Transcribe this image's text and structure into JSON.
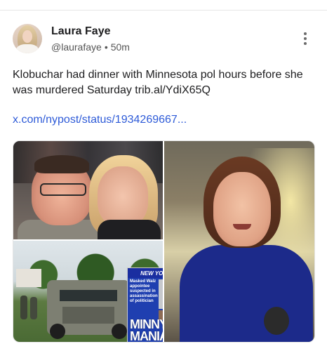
{
  "post": {
    "author_name": "Laura Faye",
    "author_handle": "@laurafaye",
    "separator": "•",
    "timestamp": "50m",
    "text": "Klobuchar had dinner with Minnesota pol hours before she was murdered Saturday trib.al/YdiX65Q",
    "link": "x.com/nypost/status/1934269667..."
  },
  "media": {
    "newspaper": {
      "masthead": "NEW YORK POST",
      "headline": "Masked Walz appointee suspected in assassination of politician",
      "big_headline": "MINNY MANIAC"
    }
  },
  "icons": {
    "more": "more-vertical-icon"
  }
}
